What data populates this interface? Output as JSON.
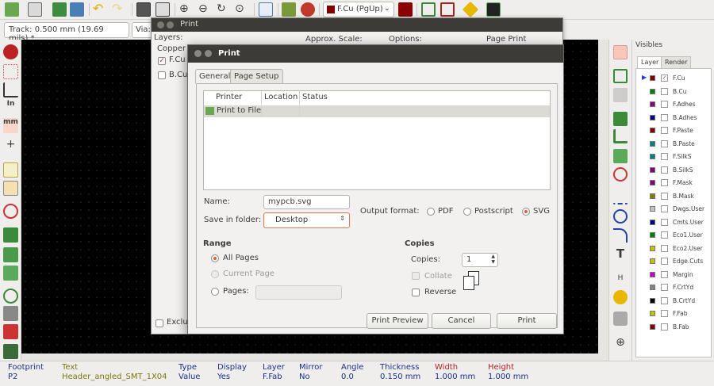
{
  "toolbar": {
    "active_layer": "F.Cu (PgUp)",
    "active_layer_color": "#800000",
    "icons": [
      "save-icon",
      "page-settings-icon",
      "footprint-editor-icon",
      "footprint-viewer-icon",
      "undo-icon",
      "redo-icon",
      "print-icon",
      "plot-icon",
      "zoom-in-icon",
      "zoom-out-icon",
      "redraw-icon",
      "zoom-fit-icon",
      "find-icon",
      "netlist-icon",
      "drc-icon",
      "auto-route-icon",
      "grid-icon",
      "highlight-icon",
      "scripting-icon"
    ]
  },
  "toolbar2": {
    "track_width": "Track: 0.500 mm (19.69 mils) *",
    "via_size": "Via:"
  },
  "back_dialog": {
    "title": "Print",
    "layers_label": "Layers:",
    "copper_label": "Copper L",
    "approx_scale_label": "Approx. Scale:",
    "options_label": "Options:",
    "page_print_label": "Page Print",
    "layers": [
      {
        "label": "F.Cu",
        "checked": true
      },
      {
        "label": "B.Cu",
        "checked": false
      }
    ],
    "exclude_label": "Exclu"
  },
  "print_dialog": {
    "title": "Print",
    "tabs": [
      {
        "label": "General",
        "active": true
      },
      {
        "label": "Page Setup",
        "active": false
      }
    ],
    "printer_table": {
      "headers": [
        "Printer",
        "Location",
        "Status"
      ],
      "rows": [
        {
          "printer": "Print to File",
          "location": "",
          "status": ""
        }
      ]
    },
    "name_label": "Name:",
    "name_value": "mypcb.svg",
    "save_in_label": "Save in folder:",
    "save_in_value": "Desktop",
    "output_format_label": "Output format:",
    "formats": [
      {
        "label": "PDF",
        "selected": false
      },
      {
        "label": "Postscript",
        "selected": false
      },
      {
        "label": "SVG",
        "selected": true
      }
    ],
    "range": {
      "title": "Range",
      "all_pages": "All Pages",
      "current_page": "Current Page",
      "pages": "Pages:"
    },
    "copies": {
      "title": "Copies",
      "copies_label": "Copies:",
      "copies_value": "1",
      "collate_label": "Collate",
      "reverse_label": "Reverse"
    },
    "buttons": {
      "preview": "Print Preview",
      "cancel": "Cancel",
      "print": "Print"
    }
  },
  "visibles": {
    "title": "Visibles",
    "tabs": [
      "Layer",
      "Render"
    ],
    "layers": [
      {
        "name": "F.Cu",
        "color": "#800000",
        "checked": true,
        "active": true
      },
      {
        "name": "B.Cu",
        "color": "#008000",
        "checked": false,
        "active": false
      },
      {
        "name": "F.Adhes",
        "color": "#800080",
        "checked": false,
        "active": false
      },
      {
        "name": "B.Adhes",
        "color": "#000080",
        "checked": false,
        "active": false
      },
      {
        "name": "F.Paste",
        "color": "#800000",
        "checked": false,
        "active": false
      },
      {
        "name": "B.Paste",
        "color": "#008080",
        "checked": false,
        "active": false
      },
      {
        "name": "F.SilkS",
        "color": "#008080",
        "checked": false,
        "active": false
      },
      {
        "name": "B.SilkS",
        "color": "#800080",
        "checked": false,
        "active": false
      },
      {
        "name": "F.Mask",
        "color": "#800080",
        "checked": false,
        "active": false
      },
      {
        "name": "B.Mask",
        "color": "#808000",
        "checked": false,
        "active": false
      },
      {
        "name": "Dwgs.User",
        "color": "#c2c2c2",
        "checked": false,
        "active": false
      },
      {
        "name": "Cmts.User",
        "color": "#000080",
        "checked": false,
        "active": false
      },
      {
        "name": "Eco1.User",
        "color": "#008000",
        "checked": false,
        "active": false
      },
      {
        "name": "Eco2.User",
        "color": "#c2c200",
        "checked": false,
        "active": false
      },
      {
        "name": "Edge.Cuts",
        "color": "#c2c200",
        "checked": false,
        "active": false
      },
      {
        "name": "Margin",
        "color": "#c200c2",
        "checked": false,
        "active": false
      },
      {
        "name": "F.CrtYd",
        "color": "#848484",
        "checked": false,
        "active": false
      },
      {
        "name": "B.CrtYd",
        "color": "#000000",
        "checked": false,
        "active": false
      },
      {
        "name": "F.Fab",
        "color": "#c2c200",
        "checked": false,
        "active": false
      },
      {
        "name": "B.Fab",
        "color": "#800000",
        "checked": false,
        "active": false
      }
    ]
  },
  "status_bar": {
    "columns": [
      {
        "header": "Footprint",
        "value": "P2"
      },
      {
        "header": "Text",
        "value": "Header_angled_SMT_1X04"
      },
      {
        "header": "Type",
        "value": "Value"
      },
      {
        "header": "Display",
        "value": "Yes"
      },
      {
        "header": "Layer",
        "value": "F.Fab"
      },
      {
        "header": "Mirror",
        "value": "No"
      },
      {
        "header": "Angle",
        "value": "0.0"
      },
      {
        "header": "Thickness",
        "value": "0.150 mm"
      },
      {
        "header": "Width",
        "value": "1.000 mm"
      },
      {
        "header": "Height",
        "value": "1.000 mm"
      }
    ]
  }
}
